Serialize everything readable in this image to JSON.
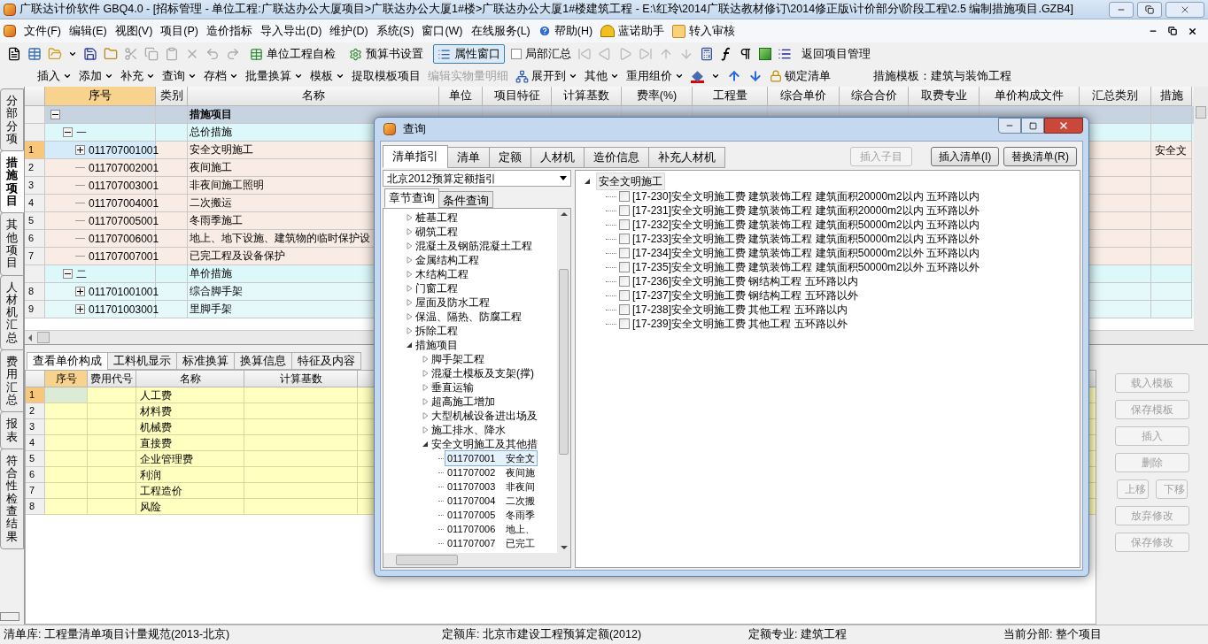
{
  "window": {
    "title": "广联达计价软件 GBQ4.0 - [招标管理 - 单位工程:广联达办公大厦项目>广联达办公大厦1#楼>广联达办公大厦1#楼建筑工程 - E:\\红玲\\2014广联达教材修订\\2014修正版\\计价部分\\阶段工程\\2.5 编制措施项目.GZB4]"
  },
  "menu": [
    {
      "label": "文件(F)",
      "kind": "plain"
    },
    {
      "label": "编辑(E)",
      "kind": "plain"
    },
    {
      "label": "视图(V)",
      "kind": "plain"
    },
    {
      "label": "项目(P)",
      "kind": "plain"
    },
    {
      "label": "造价指标",
      "kind": "plain"
    },
    {
      "label": "导入导出(D)",
      "kind": "plain"
    },
    {
      "label": "维护(D)",
      "kind": "plain"
    },
    {
      "label": "系统(S)",
      "kind": "plain"
    },
    {
      "label": "窗口(W)",
      "kind": "plain"
    },
    {
      "label": "在线服务(L)",
      "kind": "plain"
    },
    {
      "label": "帮助(H)",
      "kind": "help"
    },
    {
      "label": "蓝诺助手",
      "kind": "assistant"
    },
    {
      "label": "转入审核",
      "kind": "review"
    }
  ],
  "toolbar": [
    {
      "label": "单位工程自检",
      "kind": "check",
      "pressed": false
    },
    {
      "label": "预算书设置",
      "kind": "settings",
      "pressed": false
    },
    {
      "label": "属性窗口",
      "kind": "window",
      "pressed": true
    },
    {
      "label": "局部汇总",
      "kind": "checkbox",
      "checked": false
    },
    {
      "label": "返回项目管理",
      "kind": "plain",
      "pressed": false
    }
  ],
  "edit_toolbar": [
    {
      "label": "插入",
      "kind": "menu",
      "disabled": false
    },
    {
      "label": "添加",
      "kind": "menu",
      "disabled": false
    },
    {
      "label": "补充",
      "kind": "menu",
      "disabled": false
    },
    {
      "label": "查询",
      "kind": "menu",
      "disabled": false
    },
    {
      "label": "存档",
      "kind": "menu",
      "disabled": false
    },
    {
      "label": "批量换算",
      "kind": "menu",
      "disabled": false
    },
    {
      "label": "模板",
      "kind": "menu",
      "disabled": false
    },
    {
      "label": "提取模板项目",
      "kind": "button",
      "disabled": false
    },
    {
      "label": "编辑实物量明细",
      "kind": "button",
      "disabled": true
    },
    {
      "label": "展开到",
      "kind": "expand",
      "disabled": false
    },
    {
      "label": "其他",
      "kind": "menu",
      "disabled": false
    },
    {
      "label": "重用组价",
      "kind": "menu",
      "disabled": false
    },
    {
      "label": "锁定清单",
      "kind": "lock",
      "disabled": false
    }
  ],
  "template_label": "措施模板：建筑与装饰工程",
  "side_tabs": [
    {
      "label": "分部分项",
      "selected": false
    },
    {
      "label": "措施项目",
      "selected": true
    },
    {
      "label": "其他项目",
      "selected": false
    },
    {
      "label": "人材机汇总",
      "selected": false
    },
    {
      "label": "费用汇总",
      "selected": false
    },
    {
      "label": "报表",
      "selected": false
    },
    {
      "label": "符合性检查结果",
      "selected": false
    }
  ],
  "table": {
    "columns": [
      "序号",
      "类别",
      "名称",
      "单位",
      "项目特征",
      "计算基数",
      "费率(%)",
      "工程量",
      "综合单价",
      "综合合价",
      "取费专业",
      "单价构成文件",
      "汇总类别",
      "措施"
    ],
    "rows": [
      {
        "kind": "root",
        "name": "措施项目",
        "expanded": true,
        "children": [
          {
            "kind": "group",
            "code": "一",
            "name": "总价措施",
            "expanded": true,
            "children": [
              {
                "kind": "item",
                "number": "1",
                "code": "011707001001",
                "name": "安全文明施工",
                "expanded": false,
                "selected": true,
                "measure": "安全文"
              },
              {
                "kind": "item",
                "number": "2",
                "code": "011707002001",
                "name": "夜间施工",
                "selected": false
              },
              {
                "kind": "item",
                "number": "3",
                "code": "011707003001",
                "name": "非夜间施工照明",
                "selected": false
              },
              {
                "kind": "item",
                "number": "4",
                "code": "011707004001",
                "name": "二次搬运",
                "selected": false
              },
              {
                "kind": "item",
                "number": "5",
                "code": "011707005001",
                "name": "冬雨季施工",
                "selected": false
              },
              {
                "kind": "item",
                "number": "6",
                "code": "011707006001",
                "name": "地上、地下设施、建筑物的临时保护设",
                "selected": false
              },
              {
                "kind": "item",
                "number": "7",
                "code": "011707007001",
                "name": "已完工程及设备保护",
                "selected": false
              }
            ]
          },
          {
            "kind": "group",
            "code": "二",
            "name": "单价措施",
            "expanded": true,
            "children": [
              {
                "kind": "item",
                "number": "8",
                "code": "011701001001",
                "name": "综合脚手架",
                "expanded": false,
                "selected": false
              },
              {
                "kind": "item",
                "number": "9",
                "code": "011701003001",
                "name": "里脚手架",
                "expanded": false,
                "selected": false
              }
            ]
          }
        ]
      }
    ]
  },
  "detail_tabs": [
    {
      "label": "查看单价构成",
      "selected": true
    },
    {
      "label": "工料机显示",
      "selected": false
    },
    {
      "label": "标准换算",
      "selected": false
    },
    {
      "label": "换算信息",
      "selected": false
    },
    {
      "label": "特征及内容",
      "selected": false
    }
  ],
  "detail_table": {
    "columns": [
      "序号",
      "费用代号",
      "名称",
      "计算基数"
    ],
    "rows": [
      {
        "number": "1",
        "name": "人工费",
        "selected": true
      },
      {
        "number": "2",
        "name": "材料费",
        "selected": false
      },
      {
        "number": "3",
        "name": "机械费",
        "selected": false
      },
      {
        "number": "4",
        "name": "直接费",
        "selected": false
      },
      {
        "number": "5",
        "name": "企业管理费",
        "selected": false
      },
      {
        "number": "6",
        "name": "利润",
        "selected": false
      },
      {
        "number": "7",
        "name": "工程造价",
        "selected": false
      },
      {
        "number": "8",
        "name": "风险",
        "selected": false
      }
    ]
  },
  "side_buttons": [
    {
      "label": "载入模板",
      "disabled": true
    },
    {
      "label": "保存模板",
      "disabled": true
    },
    {
      "label": "插入",
      "disabled": true
    },
    {
      "label": "删除",
      "disabled": true
    },
    {
      "label": "上移",
      "disabled": true
    },
    {
      "label": "下移",
      "disabled": true
    },
    {
      "label": "放弃修改",
      "disabled": true
    },
    {
      "label": "保存修改",
      "disabled": true
    }
  ],
  "status_bar": [
    "清单库: 工程量清单项目计量规范(2013-北京)",
    "定额库: 北京市建设工程预算定额(2012)",
    "定额专业: 建筑工程",
    "当前分部: 整个项目"
  ],
  "dialog": {
    "title": "查询",
    "tabs": [
      {
        "label": "清单指引",
        "selected": true
      },
      {
        "label": "清单",
        "selected": false
      },
      {
        "label": "定额",
        "selected": false
      },
      {
        "label": "人材机",
        "selected": false
      },
      {
        "label": "造价信息",
        "selected": false
      },
      {
        "label": "补充人材机",
        "selected": false
      }
    ],
    "buttons": [
      {
        "label": "插入子目",
        "disabled": true
      },
      {
        "label": "插入清单(I)",
        "disabled": false
      },
      {
        "label": "替换清单(R)",
        "disabled": false
      }
    ],
    "library": "北京2012预算定额指引",
    "search_tabs": [
      {
        "label": "章节查询",
        "selected": true
      },
      {
        "label": "条件查询",
        "selected": false
      }
    ],
    "tree": [
      {
        "label": "桩基工程",
        "expanded": false
      },
      {
        "label": "砌筑工程",
        "expanded": false
      },
      {
        "label": "混凝土及钢筋混凝土工程",
        "expanded": false
      },
      {
        "label": "金属结构工程",
        "expanded": false
      },
      {
        "label": "木结构工程",
        "expanded": false
      },
      {
        "label": "门窗工程",
        "expanded": false
      },
      {
        "label": "屋面及防水工程",
        "expanded": false
      },
      {
        "label": "保温、隔热、防腐工程",
        "expanded": false
      },
      {
        "label": "拆除工程",
        "expanded": false
      },
      {
        "label": "措施项目",
        "expanded": true,
        "children": [
          {
            "label": "脚手架工程",
            "expanded": false
          },
          {
            "label": "混凝土模板及支架(撑)",
            "expanded": false
          },
          {
            "label": "垂直运输",
            "expanded": false
          },
          {
            "label": "超高施工增加",
            "expanded": false
          },
          {
            "label": "大型机械设备进出场及",
            "expanded": false
          },
          {
            "label": "施工排水、降水",
            "expanded": false
          },
          {
            "label": "安全文明施工及其他措",
            "expanded": true,
            "children": [
              {
                "code": "011707001",
                "label": "安全文",
                "selected": true
              },
              {
                "code": "011707002",
                "label": "夜间施",
                "selected": false
              },
              {
                "code": "011707003",
                "label": "非夜间",
                "selected": false
              },
              {
                "code": "011707004",
                "label": "二次搬",
                "selected": false
              },
              {
                "code": "011707005",
                "label": "冬雨季",
                "selected": false
              },
              {
                "code": "011707006",
                "label": "地上、",
                "selected": false
              },
              {
                "code": "011707007",
                "label": "已完工",
                "selected": false
              }
            ]
          }
        ]
      }
    ],
    "result_root": {
      "label": "安全文明施工",
      "selected": true
    },
    "results": [
      {
        "label": "[17-230]安全文明施工费 建筑装饰工程 建筑面积20000m2以内 五环路以内",
        "checked": false
      },
      {
        "label": "[17-231]安全文明施工费 建筑装饰工程 建筑面积20000m2以内 五环路以外",
        "checked": false
      },
      {
        "label": "[17-232]安全文明施工费 建筑装饰工程 建筑面积50000m2以内 五环路以内",
        "checked": false
      },
      {
        "label": "[17-233]安全文明施工费 建筑装饰工程 建筑面积50000m2以内 五环路以外",
        "checked": false
      },
      {
        "label": "[17-234]安全文明施工费 建筑装饰工程 建筑面积50000m2以外 五环路以内",
        "checked": false
      },
      {
        "label": "[17-235]安全文明施工费 建筑装饰工程 建筑面积50000m2以外 五环路以外",
        "checked": false
      },
      {
        "label": "[17-236]安全文明施工费 钢结构工程 五环路以内",
        "checked": false
      },
      {
        "label": "[17-237]安全文明施工费 钢结构工程 五环路以外",
        "checked": false
      },
      {
        "label": "[17-238]安全文明施工费 其他工程 五环路以内",
        "checked": false
      },
      {
        "label": "[17-239]安全文明施工费 其他工程 五环路以外",
        "checked": false
      }
    ]
  }
}
